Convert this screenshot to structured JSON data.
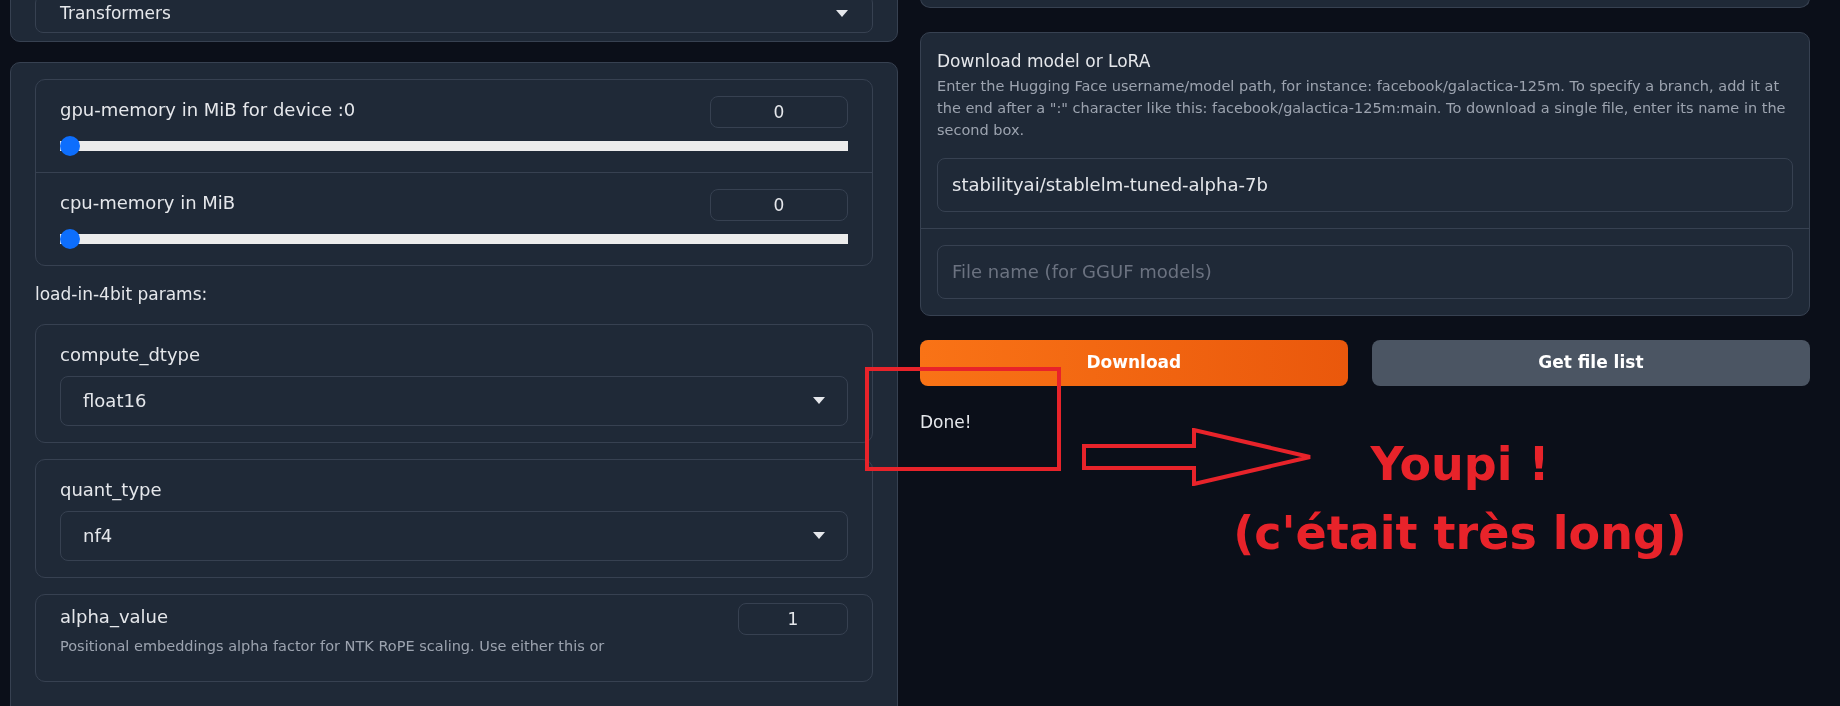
{
  "loader": {
    "value": "Transformers"
  },
  "memory": [
    {
      "label": "gpu-memory in MiB for device :0",
      "value": "0",
      "level": 0
    },
    {
      "label": "cpu-memory in MiB",
      "value": "0",
      "level": 0
    }
  ],
  "section_label": "load-in-4bit params:",
  "dropdowns": [
    {
      "label": "compute_dtype",
      "value": "float16"
    },
    {
      "label": "quant_type",
      "value": "nf4"
    }
  ],
  "alpha": {
    "label": "alpha_value",
    "value": "1",
    "description": "Positional embeddings alpha factor for NTK RoPE scaling. Use either this or"
  },
  "download": {
    "title": "Download model or LoRA",
    "description": "Enter the Hugging Face username/model path, for instance: facebook/galactica-125m. To specify a branch, add it at the end after a \":\" character like this: facebook/galactica-125m:main. To download a single file, enter its name in the second box.",
    "model_value": "stabilityai/stablelm-tuned-alpha-7b",
    "file_placeholder": "File name (for GGUF models)"
  },
  "buttons": [
    {
      "label": "Download",
      "kind": "primary"
    },
    {
      "label": "Get file list",
      "kind": "secondary"
    }
  ],
  "status": "Done!",
  "annotation": {
    "lines": [
      "Youpi !",
      "(c'était très long)"
    ]
  }
}
